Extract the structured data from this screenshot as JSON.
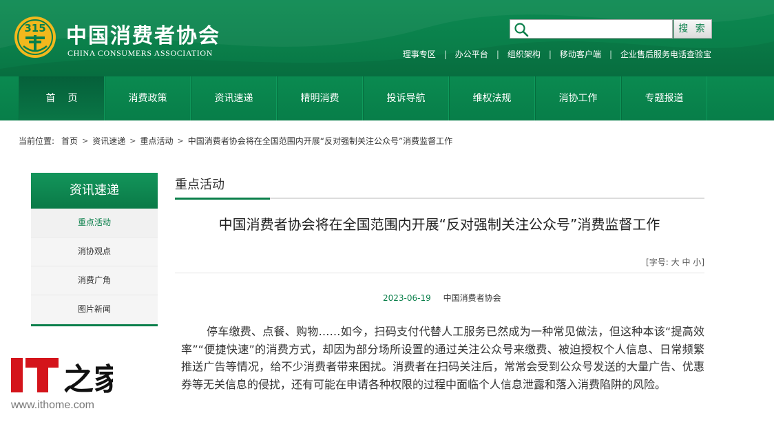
{
  "header": {
    "title": "中国消费者协会",
    "subtitle": "CHINA CONSUMERS ASSOCIATION",
    "logo_text": "315",
    "search": {
      "placeholder": "",
      "button_label": "搜 索"
    },
    "top_links": [
      "理事专区",
      "办公平台",
      "组织架构",
      "移动客户端",
      "企业售后服务电话查验宝"
    ]
  },
  "nav": {
    "items": [
      "首页",
      "消费政策",
      "资讯速递",
      "精明消费",
      "投诉导航",
      "维权法规",
      "消协工作",
      "专题报道"
    ]
  },
  "breadcrumb": {
    "label": "当前位置:",
    "items": [
      "首页",
      "资讯速递",
      "重点活动",
      "中国消费者协会将在全国范围内开展“反对强制关注公众号”消费监督工作"
    ]
  },
  "sidebar": {
    "title": "资讯速递",
    "items": [
      "重点活动",
      "消协观点",
      "消费广角",
      "图片新闻"
    ]
  },
  "main": {
    "section_title": "重点活动",
    "article": {
      "title": "中国消费者协会将在全国范围内开展“反对强制关注公众号”消费监督工作",
      "font_size_label": "[字号:",
      "font_size_options": [
        "大",
        "中",
        "小"
      ],
      "font_size_close": "]",
      "date": "2023-06-19",
      "source": "中国消费者协会",
      "body": "停车缴费、点餐、购物……如今，扫码支付代替人工服务已然成为一种常见做法，但这种本该“提高效率”“便捷快速”的消费方式，却因为部分场所设置的通过关注公众号来缴费、被迫授权个人信息、日常频繁推送广告等情况，给不少消费者带来困扰。消费者在扫码关注后，常常会受到公众号发送的大量广告、优惠券等无关信息的侵扰，还有可能在申请各种权限的过程中面临个人信息泄露和落入消费陷阱的风险。"
    }
  },
  "watermark": {
    "brand": "IT之家",
    "url": "www.ithome.com"
  },
  "colors": {
    "brand_green": "#0a7f4a",
    "nav_active": "#05603a",
    "logo_gold": "#f2b81d",
    "watermark_red": "#d4141b"
  }
}
